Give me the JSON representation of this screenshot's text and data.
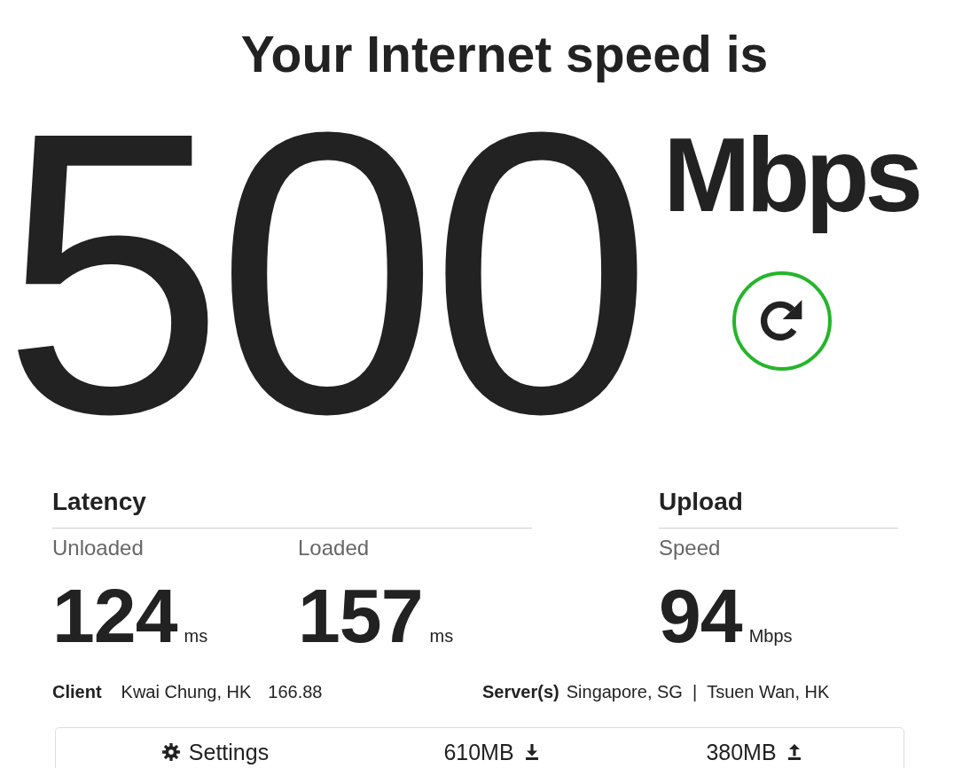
{
  "title": "Your Internet speed is",
  "speed": {
    "value": "500",
    "unit": "Mbps"
  },
  "latency": {
    "heading": "Latency",
    "metrics": [
      {
        "label": "Unloaded",
        "value": "124",
        "unit": "ms"
      },
      {
        "label": "Loaded",
        "value": "157",
        "unit": "ms"
      }
    ]
  },
  "upload": {
    "heading": "Upload",
    "metrics": [
      {
        "label": "Speed",
        "value": "94",
        "unit": "Mbps"
      }
    ]
  },
  "client": {
    "label": "Client",
    "location": "Kwai Chung, HK",
    "ip": "166.88"
  },
  "servers": {
    "label": "Server(s)",
    "locations": [
      "Singapore, SG",
      "Tsuen Wan, HK"
    ],
    "separator": "|"
  },
  "footer": [
    {
      "kind": "settings",
      "label": "Settings"
    },
    {
      "kind": "download",
      "label": "610MB"
    },
    {
      "kind": "upload",
      "label": "380MB"
    }
  ]
}
